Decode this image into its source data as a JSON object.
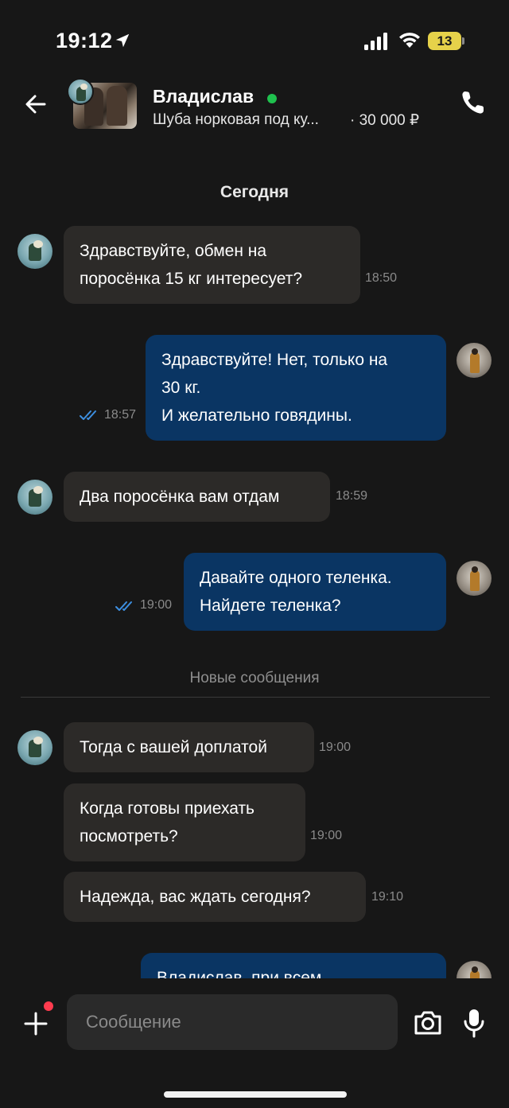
{
  "status_bar": {
    "time": "19:12",
    "battery": "13"
  },
  "header": {
    "contact_name": "Владислав",
    "listing_title": "Шуба норковая под ку...",
    "listing_price": "· 30 000 ₽"
  },
  "chat": {
    "date_label": "Сегодня",
    "new_messages_label": "Новые сообщения",
    "messages": [
      {
        "lines": [
          "Здравствуйте, обмен на",
          "поросёнка 15 кг интересует?"
        ],
        "time": "18:50",
        "direction": "incoming"
      },
      {
        "lines": [
          "Здравствуйте! Нет, только на",
          "30 кг.",
          "И желательно говядины."
        ],
        "time": "18:57",
        "direction": "outgoing"
      },
      {
        "lines": [
          "Два поросёнка вам отдам"
        ],
        "time": "18:59",
        "direction": "incoming"
      },
      {
        "lines": [
          "Давайте одного теленка.",
          "Найдете теленка?"
        ],
        "time": "19:00",
        "direction": "outgoing"
      },
      {
        "lines": [
          "Тогда с вашей доплатой"
        ],
        "time": "19:00",
        "direction": "incoming"
      },
      {
        "lines": [
          "Когда готовы приехать",
          "посмотреть?"
        ],
        "time": "19:00",
        "direction": "incoming"
      },
      {
        "lines": [
          "Надежда, вас ждать сегодня?"
        ],
        "time": "19:10",
        "direction": "incoming"
      },
      {
        "lines": [
          "Владислав, при всем"
        ],
        "time": "",
        "direction": "outgoing"
      }
    ]
  },
  "input": {
    "placeholder": "Сообщение"
  },
  "colors": {
    "background": "#171717",
    "incoming_bubble": "#2c2a28",
    "outgoing_bubble": "#0a3563",
    "online": "#1fc14e",
    "read_ticks": "#3d8fe0",
    "badge": "#ff3b4e"
  },
  "icons": [
    "location-arrow-icon",
    "signal-icon",
    "wifi-icon",
    "battery-icon",
    "back-arrow-icon",
    "phone-icon",
    "plus-icon",
    "camera-icon",
    "microphone-icon",
    "double-check-icon"
  ]
}
